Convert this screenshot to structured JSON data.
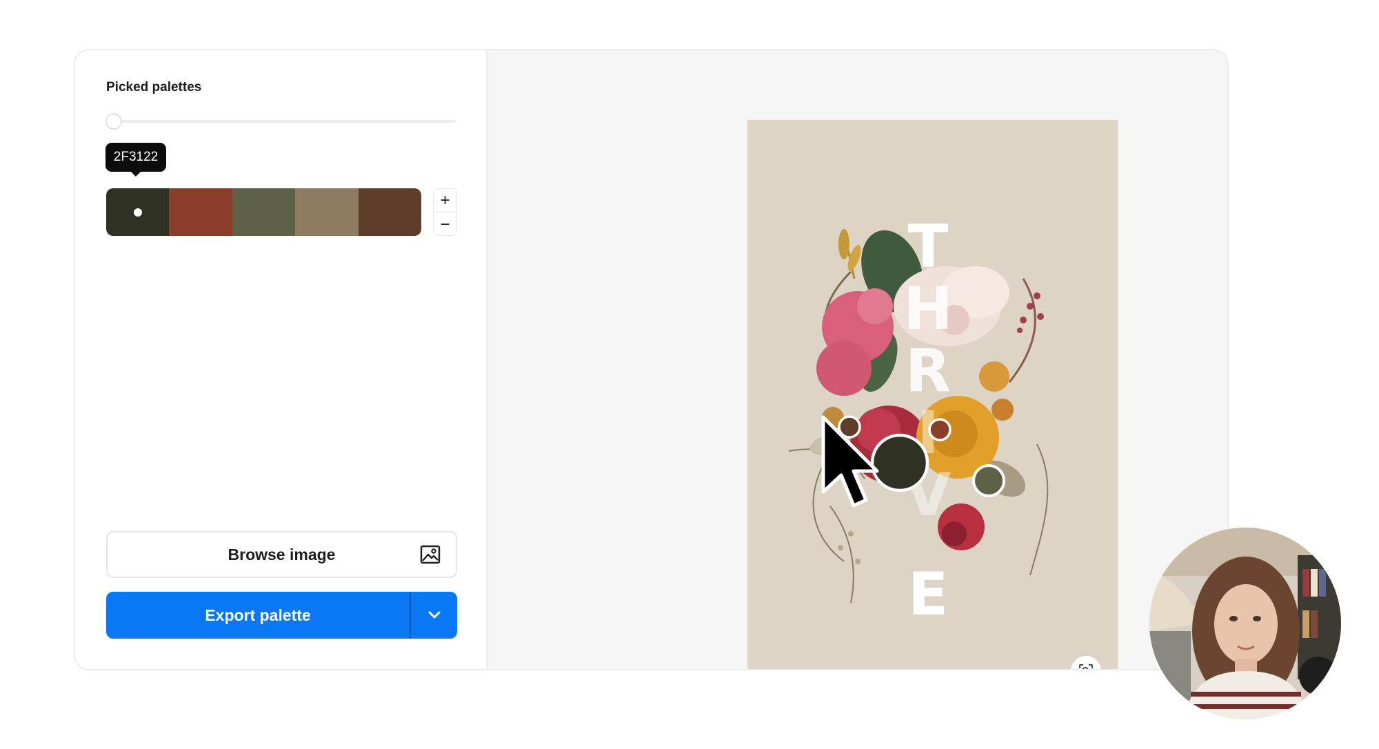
{
  "left_panel": {
    "title": "Picked palettes",
    "selected_hex": "2F3122",
    "swatches": [
      {
        "hex": "#2F3122",
        "selected": true
      },
      {
        "hex": "#8A3E2A",
        "selected": false
      },
      {
        "hex": "#5E6146",
        "selected": false
      },
      {
        "hex": "#8E7A60",
        "selected": false
      },
      {
        "hex": "#5E3D2B",
        "selected": false
      }
    ],
    "stepper": {
      "plus": "+",
      "minus": "−"
    },
    "browse_label": "Browse image",
    "browse_icon": "image-icon",
    "export_label": "Export palette",
    "export_dropdown_icon": "chevron-down-icon"
  },
  "preview": {
    "background": "#DDD4C6",
    "poster_letters": [
      "T",
      "H",
      "R",
      "I",
      "V",
      "E"
    ],
    "picker_markers": [
      {
        "color": "#5E3D2B"
      },
      {
        "color": "#8A3E2A"
      },
      {
        "color": "#2F3122"
      },
      {
        "color": "#5E6146"
      }
    ],
    "zoom_icon": "zoom-scan-icon"
  },
  "colors": {
    "accent": "#0A78F5",
    "accent_divider": "#0456B3"
  }
}
